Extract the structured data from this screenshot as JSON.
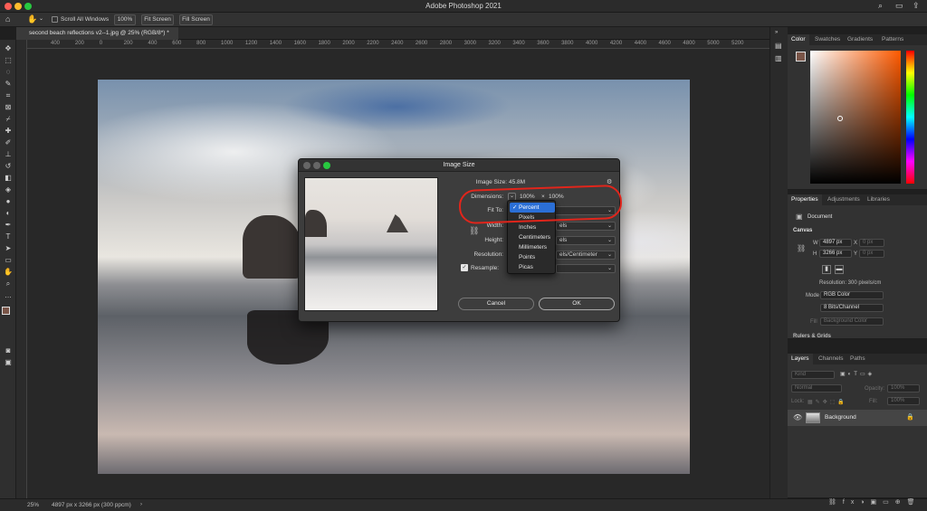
{
  "app": {
    "title": "Adobe Photoshop 2021",
    "traffic_colors": [
      "#ff5f57",
      "#febc2e",
      "#28c840"
    ]
  },
  "options_bar": {
    "scroll_all_windows": "Scroll All Windows",
    "zoom_100": "100%",
    "fit_screen": "Fit Screen",
    "fill_screen": "Fill Screen"
  },
  "document": {
    "tab_title": "second beach reflections v2--1.jpg @ 25% (RGB/8*) *"
  },
  "ruler": {
    "ticks": [
      "400",
      "200",
      "0",
      "200",
      "400",
      "600",
      "800",
      "1000",
      "1200",
      "1400",
      "1600",
      "1800",
      "2000",
      "2200",
      "2400",
      "2600",
      "2800",
      "3000",
      "3200",
      "3400",
      "3600",
      "3800",
      "4000",
      "4200",
      "4400",
      "4600",
      "4800",
      "5000",
      "5200"
    ]
  },
  "status": {
    "zoom": "25%",
    "info": "4897 px x 3266 px (300 ppcm)"
  },
  "color_panel": {
    "tabs": [
      "Color",
      "Swatches",
      "Gradients",
      "Patterns"
    ]
  },
  "properties_panel": {
    "tabs": [
      "Properties",
      "Adjustments",
      "Libraries"
    ],
    "doc_label": "Document",
    "canvas_heading": "Canvas",
    "w_label": "W",
    "w_value": "4897 px",
    "x_label": "X",
    "x_value": "0 px",
    "h_label": "H",
    "h_value": "3266 px",
    "y_label": "Y",
    "y_value": "0 px",
    "resolution": "Resolution: 300 pixels/cm",
    "mode_label": "Mode",
    "mode_value": "RGB Color",
    "bits_value": "8 Bits/Channel",
    "fill_label": "Fill",
    "fill_value": "Background Color",
    "rulers_grids": "Rulers & Grids"
  },
  "layers_panel": {
    "tabs": [
      "Layers",
      "Channels",
      "Paths"
    ],
    "kind": "Kind",
    "blend": "Normal",
    "opacity_label": "Opacity:",
    "opacity_value": "100%",
    "lock_label": "Lock:",
    "fill_label": "Fill:",
    "fill_value": "100%",
    "layer_name": "Background"
  },
  "dialog": {
    "title": "Image Size",
    "image_size_label": "Image Size:",
    "image_size_value": "45.8M",
    "dimensions_label": "Dimensions:",
    "dimensions_w": "100%",
    "dimensions_x": "×",
    "dimensions_h": "100%",
    "fit_to_label": "Fit To:",
    "width_label": "Width:",
    "width_unit_partial": "els",
    "height_label": "Height:",
    "height_unit_partial": "els",
    "resolution_label": "Resolution:",
    "resolution_unit_partial": "els/Centimeter",
    "resample_label": "Resample:",
    "cancel": "Cancel",
    "ok": "OK"
  },
  "dropdown": {
    "selected": "Percent",
    "items": [
      "Pixels",
      "Inches",
      "Centimeters",
      "Millimeters",
      "Points",
      "Picas"
    ]
  },
  "annotation_color": "#e1251b"
}
